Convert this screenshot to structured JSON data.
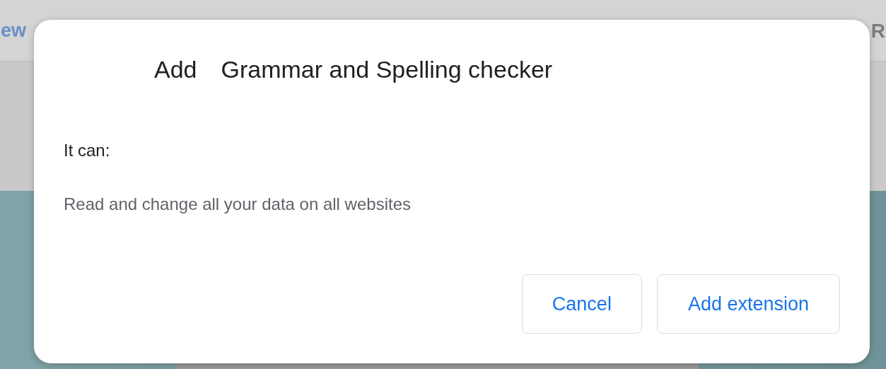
{
  "background": {
    "left_text": "ew",
    "right_text": "R"
  },
  "dialog": {
    "title_verb": "Add",
    "title_name": "Grammar and Spelling checker",
    "section_label": "It can:",
    "permissions": [
      "Read and change all your data on all websites"
    ],
    "buttons": [
      {
        "label": "Cancel",
        "kind": "secondary"
      },
      {
        "label": "Add extension",
        "kind": "primary"
      }
    ]
  }
}
